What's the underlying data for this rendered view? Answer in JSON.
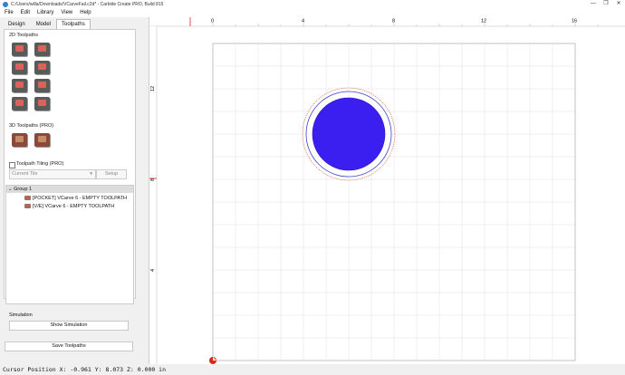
{
  "window": {
    "title": "C:/Users/willa/Downloads/VCarveFail.c2d* - Carbide Create PRO, Build 815",
    "controls": [
      "—",
      "❐",
      "✕"
    ]
  },
  "menu": [
    "File",
    "Edit",
    "Library",
    "View",
    "Help"
  ],
  "tabs": [
    {
      "label": "Design",
      "active": false
    },
    {
      "label": "Model",
      "active": false
    },
    {
      "label": "Toolpaths",
      "active": true
    }
  ],
  "toolpaths2d_label": "2D Toolpaths",
  "toolpaths3d_label": "3D Toolpaths (PRO)",
  "tiling": {
    "label": "Toolpath Tiling (PRO)",
    "checked": false,
    "current_tile": "Current Tile",
    "setup": "Setup"
  },
  "tree": {
    "group": "Group 1",
    "items": [
      "[POCKET] VCarve 6 - EMPTY TOOLPATH",
      "[V/E] VCarve 6 - EMPTY TOOLPATH"
    ]
  },
  "simulation": {
    "label": "Simulation",
    "button": "Show Simulation"
  },
  "save_button": "Save Toolpaths",
  "ruler": {
    "x_ticks": [
      "0",
      "4",
      "8",
      "12",
      "16"
    ],
    "y_ticks": [
      "12",
      "8",
      "4"
    ]
  },
  "circle": {
    "fill": "#3a1ff0"
  },
  "status": "Cursor Position X: -0.961 Y: 8.073 Z: 0.000 in"
}
